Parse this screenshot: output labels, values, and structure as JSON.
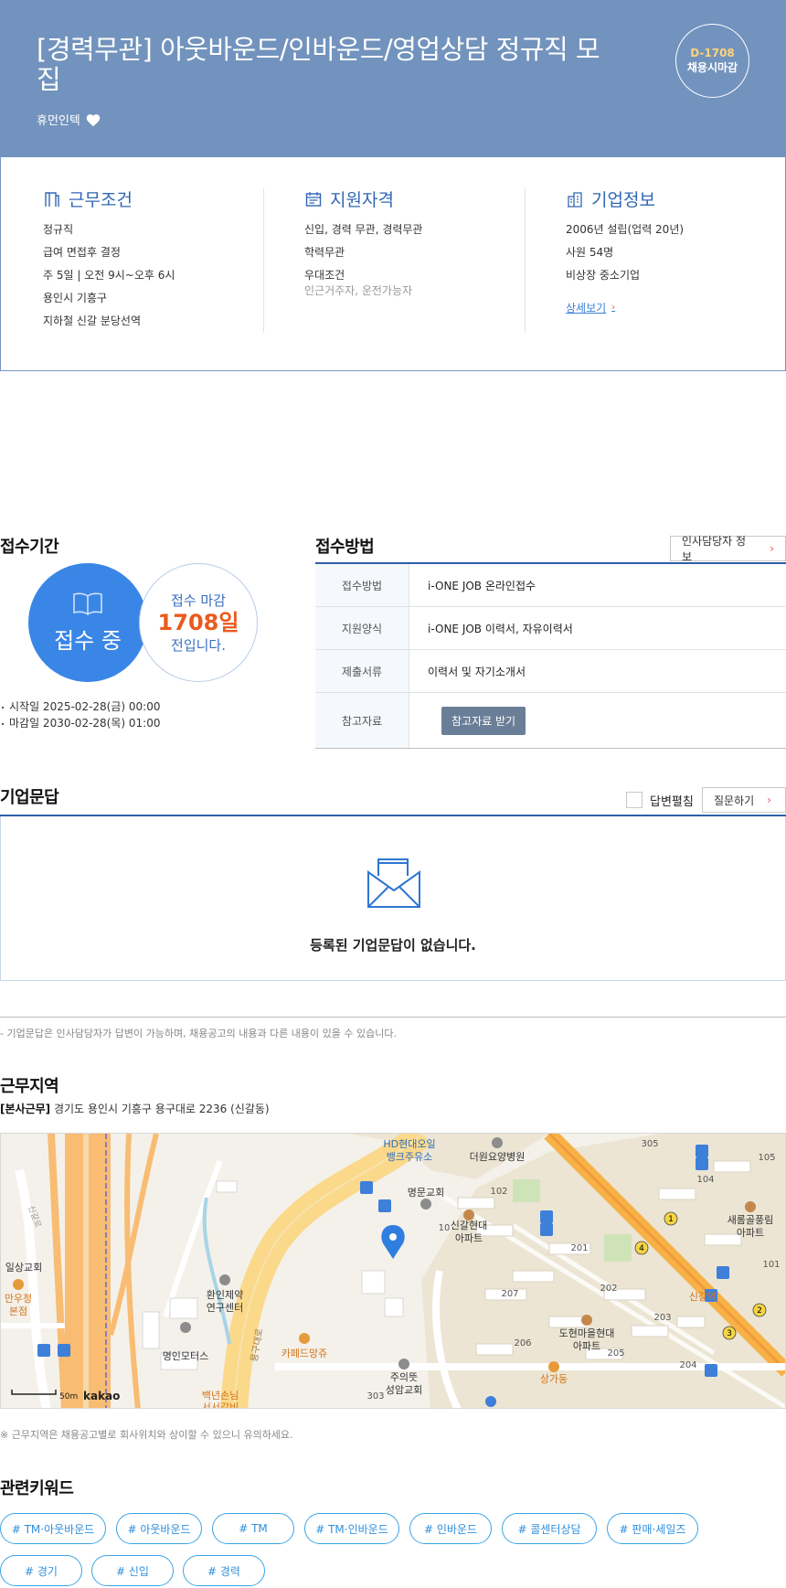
{
  "header": {
    "title": "[경력무관] 아웃바운드/인바운드/영업상담 정규직 모집",
    "company": "휴먼인텍",
    "dday_count": "D-1708",
    "dday_label": "채용시마감"
  },
  "summary": {
    "work": {
      "title": "근무조건",
      "items": [
        "정규직",
        "급여 면접후 결정",
        "주 5일 | 오전 9시~오후 6시",
        "용인시 기흥구",
        "지하철 신갈 분당선역"
      ]
    },
    "qualification": {
      "title": "지원자격",
      "items": [
        "신입, 경력 무관, 경력무관",
        "학력무관",
        "우대조건"
      ],
      "sub": "인근거주자, 운전가능자"
    },
    "company": {
      "title": "기업정보",
      "items": [
        "2006년 설립(업력 20년)",
        "사원 54명",
        "비상장 중소기업"
      ],
      "link": "상세보기"
    }
  },
  "period": {
    "title": "접수기간",
    "status": "접수 중",
    "remain_l1": "접수 마감",
    "remain_days": "1708일",
    "remain_l3": "전입니다.",
    "start": "시작일 2025-02-28(금) 00:00",
    "end": "마감일 2030-02-28(목) 01:00"
  },
  "method": {
    "title": "접수방법",
    "hr_button": "인사담당자 정보",
    "rows": [
      {
        "head": "접수방법",
        "value": "i-ONE JOB 온라인접수"
      },
      {
        "head": "지원양식",
        "value": "i-ONE JOB 이력서, 자유이력서"
      },
      {
        "head": "제출서류",
        "value": "이력서 및 자기소개서"
      },
      {
        "head": "참고자료",
        "button": "참고자료 받기"
      }
    ]
  },
  "qa": {
    "title": "기업문답",
    "toggle_label": "답변펼침",
    "ask_button": "질문하기",
    "empty": "등록된 기업문답이 없습니다.",
    "note": "- 기업문답은 인사담당자가 답변이 가능하며, 채용공고의 내용과 다른 내용이 있을 수 있습니다."
  },
  "location": {
    "title": "근무지역",
    "tag": "[본사근무]",
    "address": "경기도 용인시 기흥구 용구대로 2236 (신갈동)",
    "map_labels": {
      "hd": "HD현대오일",
      "hd2": "뱅크주유소",
      "hospital": "더원요양병원",
      "church1": "명문교회",
      "apt1": "신갈현대",
      "apt1b": "아파트",
      "church2": "일상교회",
      "mando": "만우정",
      "mando2": "본점",
      "lab": "환인제약",
      "lab2": "연구센터",
      "motors": "명인모터스",
      "cafe": "카페드망쥬",
      "church3": "주의뜻",
      "church3b": "성암교회",
      "food": "백년손님",
      "food2": "서서갈비",
      "apt2": "도현마을현대",
      "apt2b": "아파트",
      "apt3": "새롬골풍림",
      "apt3b": "아파트",
      "station": "신갈역",
      "mall": "상가동",
      "road": "용구대로",
      "sanglo": "신갈로",
      "scale": "50m",
      "brand": "kakao",
      "n102": "102",
      "n103": "103",
      "n104": "104",
      "n105": "105",
      "n201": "201",
      "n202": "202",
      "n203": "203",
      "n204": "204",
      "n205": "205",
      "n206": "206",
      "n207": "207",
      "n101": "101",
      "n303": "303",
      "n305": "305",
      "n10": "10"
    },
    "note": "※ 근무지역은 채용공고별로 회사위치와 상이할 수 있으니 유의하세요."
  },
  "keywords": {
    "title": "관련키워드",
    "items": [
      "# TM·아웃바운드",
      "# 아웃바운드",
      "# TM",
      "# TM·인바운드",
      "# 인바운드",
      "# 콜센터상담",
      "# 판매·세일즈",
      "# 경기",
      "# 신입",
      "# 경력"
    ]
  },
  "colors": {
    "header_bg": "#7293bd",
    "accent_blue": "#3a86e6",
    "accent_orange": "#ea5a1c",
    "navy_line": "#2f5ea8"
  }
}
